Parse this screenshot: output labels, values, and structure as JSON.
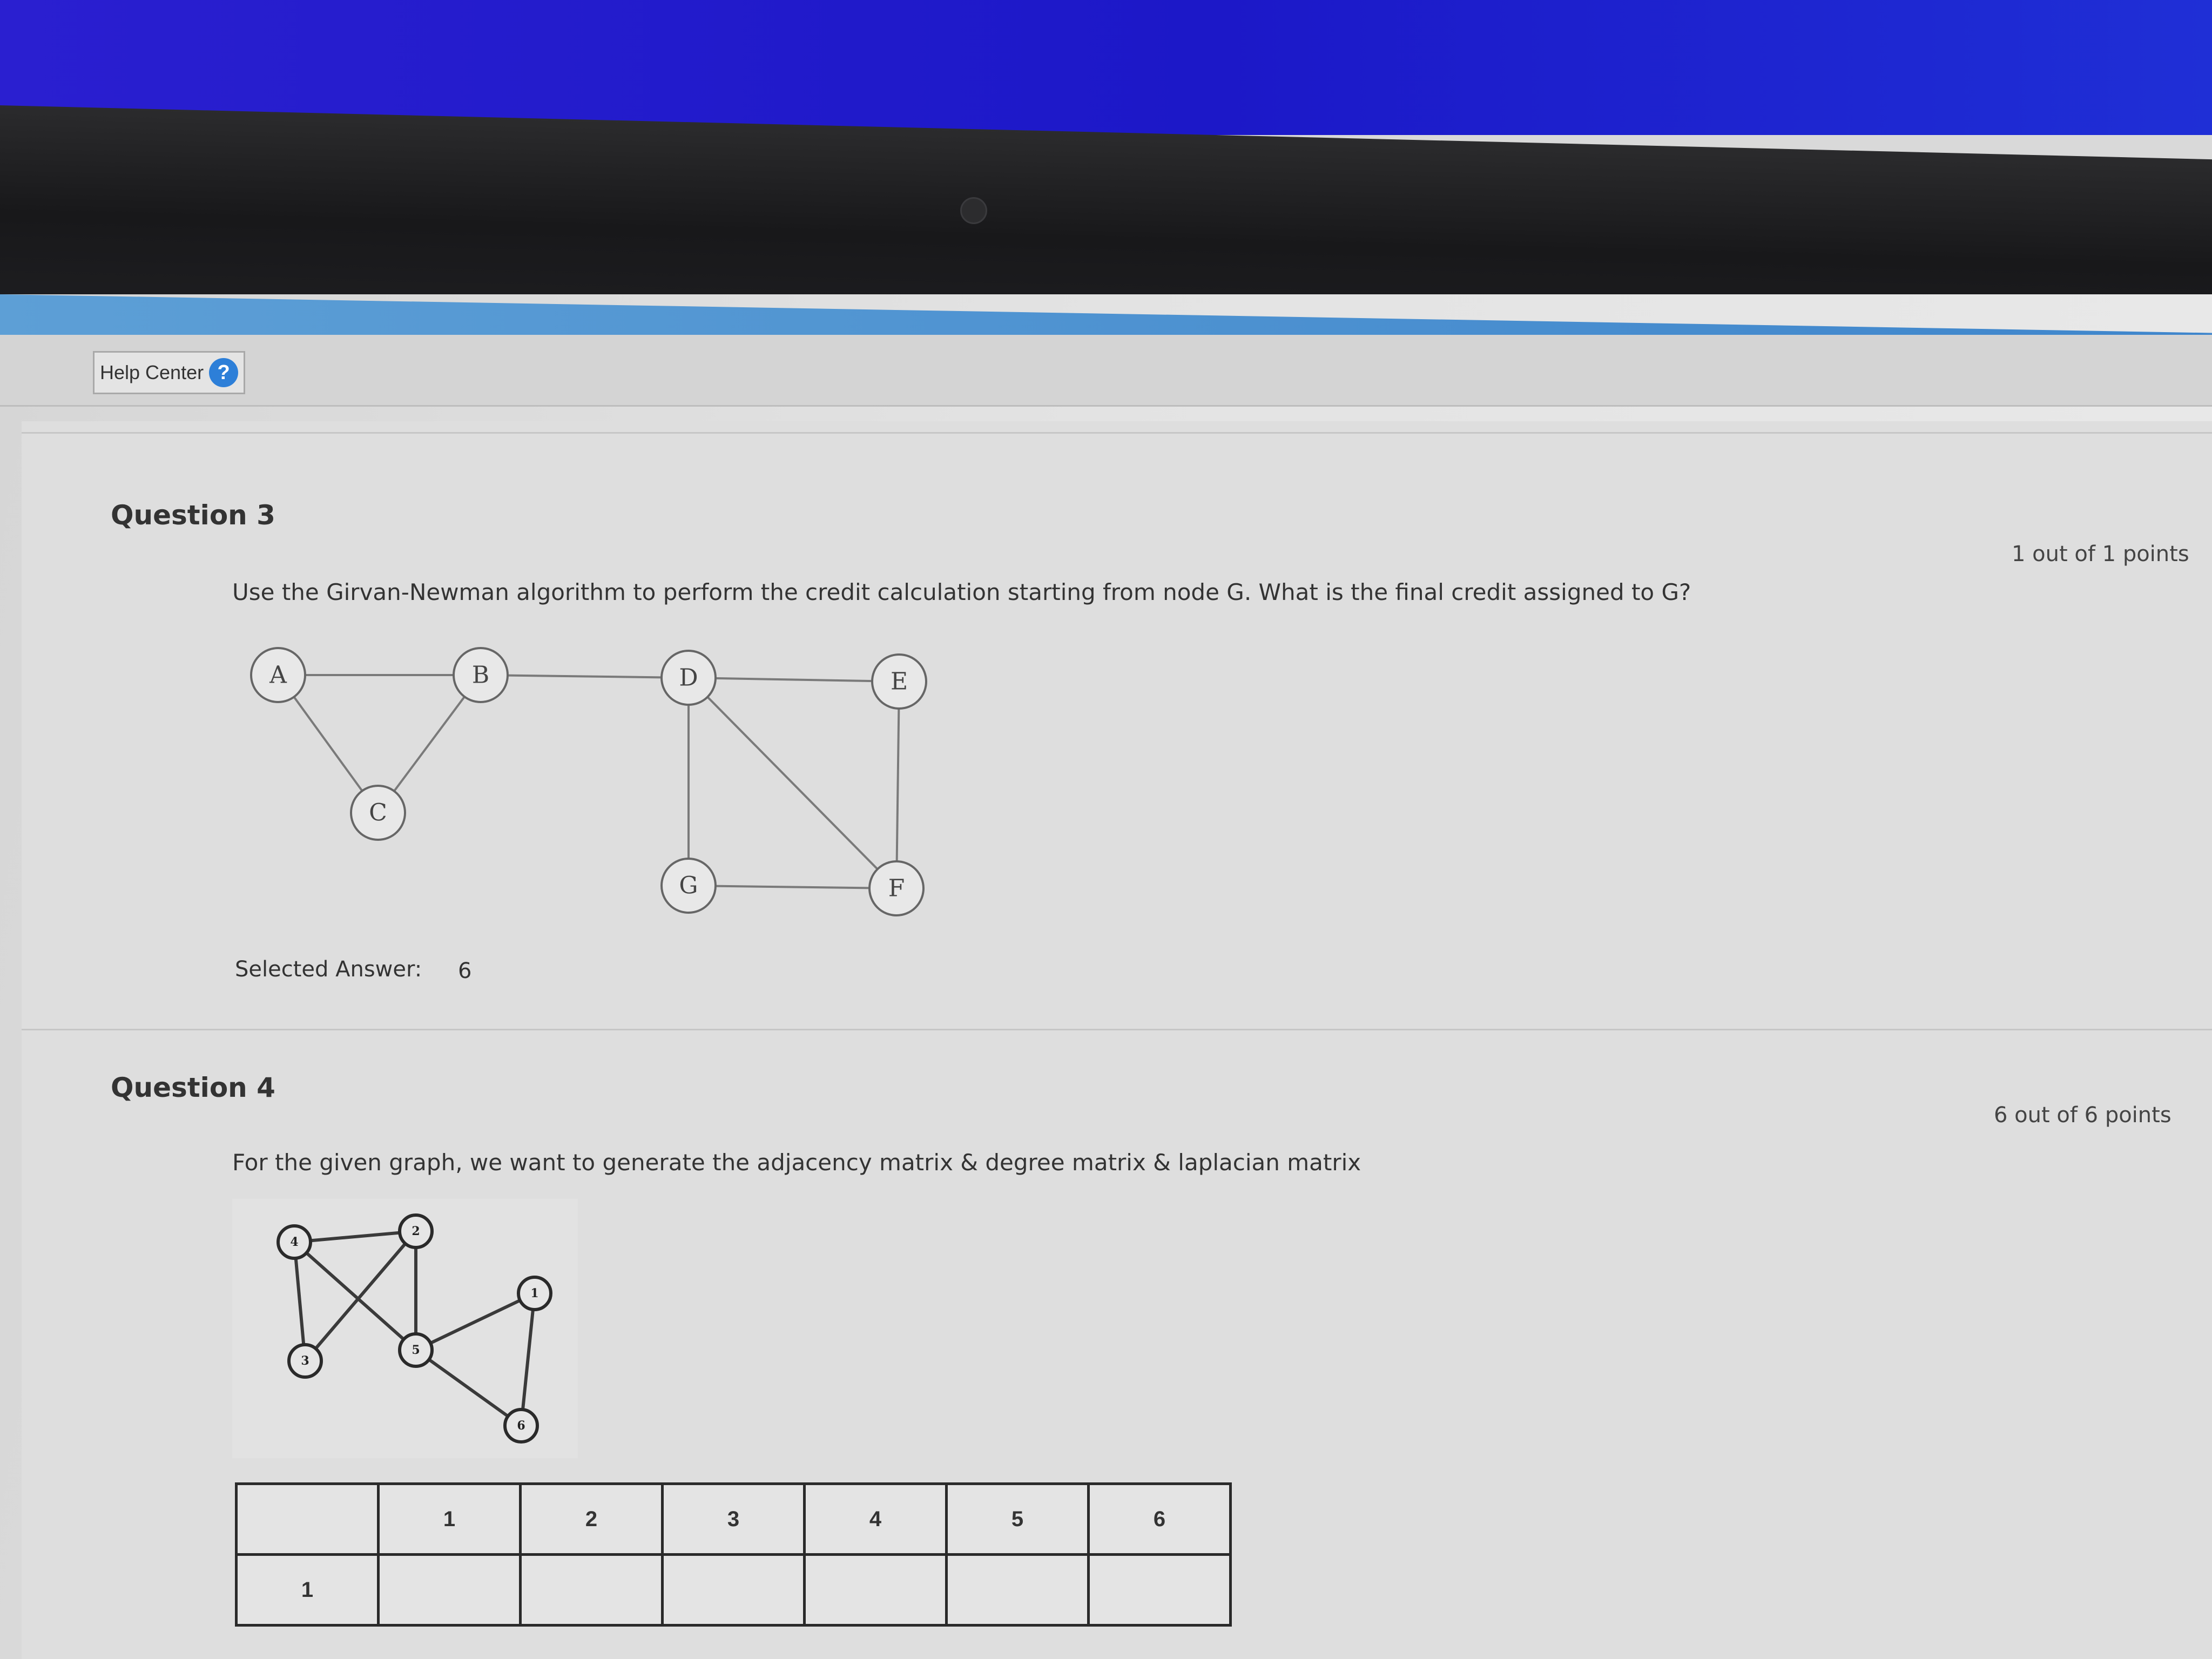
{
  "help_center": {
    "label": "Help Center",
    "icon": "question-icon"
  },
  "question3": {
    "title": "Question 3",
    "points": "1 out of 1 points",
    "text": "Use the Girvan-Newman algorithm to perform the credit calculation starting from node G. What is the final credit assigned to G?",
    "graph": {
      "nodes": [
        "A",
        "B",
        "C",
        "D",
        "E",
        "F",
        "G"
      ],
      "edges": [
        [
          "A",
          "B"
        ],
        [
          "A",
          "C"
        ],
        [
          "B",
          "C"
        ],
        [
          "B",
          "D"
        ],
        [
          "D",
          "E"
        ],
        [
          "D",
          "G"
        ],
        [
          "D",
          "F"
        ],
        [
          "E",
          "F"
        ],
        [
          "G",
          "F"
        ]
      ]
    },
    "selected_answer_label": "Selected Answer:",
    "selected_answer_value": "6"
  },
  "question4": {
    "title": "Question 4",
    "points": "6 out of 6 points",
    "text": "For the given graph, we want to generate the adjacency matrix & degree matrix & laplacian matrix",
    "graph": {
      "nodes": [
        "1",
        "2",
        "3",
        "4",
        "5",
        "6"
      ],
      "edges": [
        [
          "4",
          "2"
        ],
        [
          "4",
          "3"
        ],
        [
          "4",
          "5"
        ],
        [
          "2",
          "3"
        ],
        [
          "2",
          "5"
        ],
        [
          "5",
          "1"
        ],
        [
          "5",
          "6"
        ],
        [
          "1",
          "6"
        ]
      ]
    },
    "matrix": {
      "column_headers": [
        "1",
        "2",
        "3",
        "4",
        "5",
        "6"
      ],
      "row_headers": [
        "1"
      ]
    }
  },
  "colors": {
    "accent": "#2d7fd8",
    "text": "#333333",
    "node_stroke": "#555555"
  }
}
